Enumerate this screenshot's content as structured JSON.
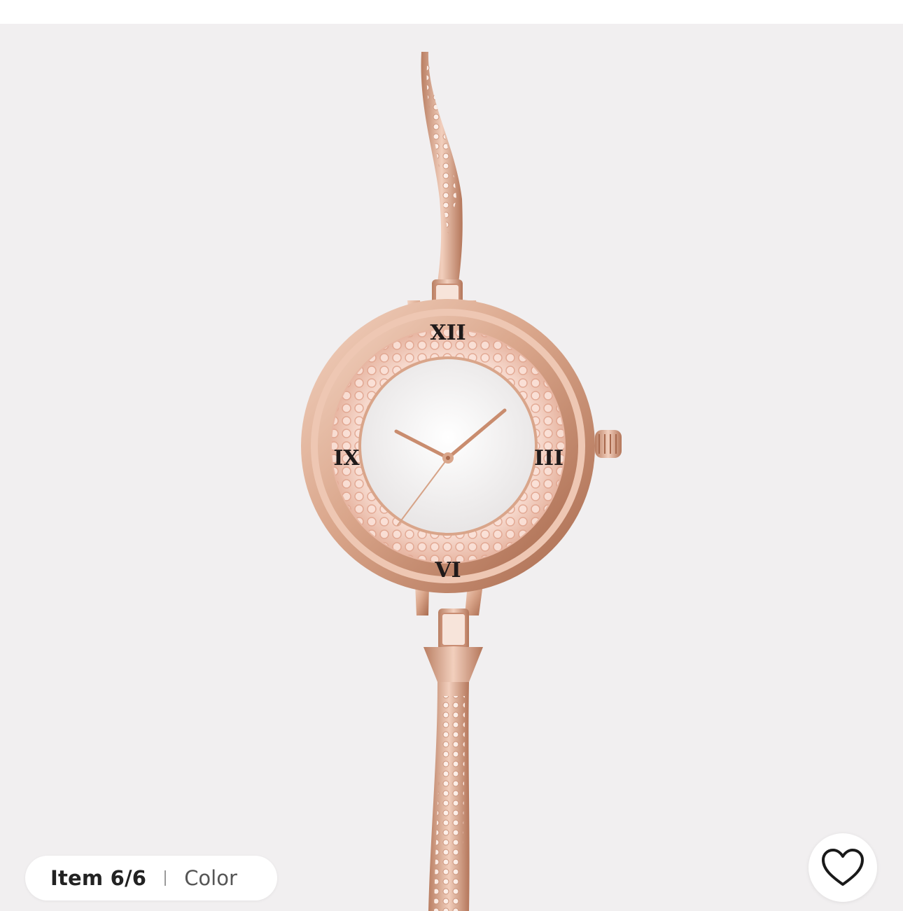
{
  "product_image": {
    "alt": "Rose gold bangle watch with crystal bezel",
    "dial_numerals": [
      "XII",
      "III",
      "VI",
      "IX"
    ]
  },
  "gallery": {
    "item_counter": "Item 6/6",
    "variant_label": "Color"
  },
  "favorite": {
    "icon": "heart-outline-icon"
  },
  "colors": {
    "background": "#f1eff0",
    "rose_gold": "#d9a58a",
    "rose_gold_dark": "#b57a5e",
    "dial": "#f4f2f2",
    "numerals": "#1f1a1a"
  }
}
